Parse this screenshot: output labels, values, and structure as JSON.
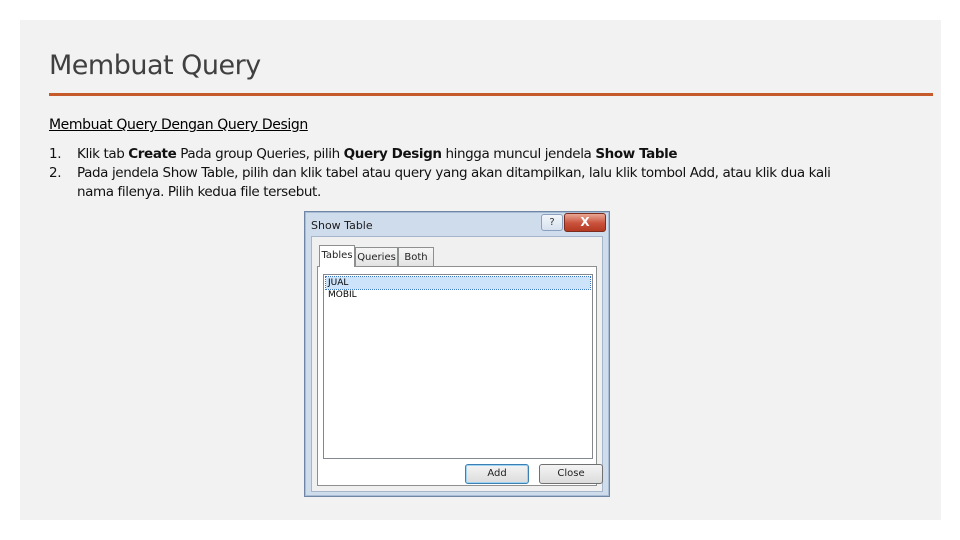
{
  "slide": {
    "title": "Membuat Query",
    "subheading": "Membuat Query Dengan Query Design",
    "steps": [
      {
        "num": "1.",
        "parts": [
          "Klik tab ",
          "Create",
          " Pada group Queries, pilih ",
          "Query Design",
          " hingga muncul jendela ",
          "Show Table"
        ]
      },
      {
        "num": "2.",
        "text": "Pada jendela Show Table, pilih dan klik tabel atau query yang akan ditampilkan, lalu klik tombol Add, atau klik dua kali nama filenya. Pilih kedua file tersebut."
      }
    ],
    "accent_color": "#c55a2b"
  },
  "dialog": {
    "title": "Show Table",
    "help_label": "?",
    "close_label": "X",
    "tabs": [
      "Tables",
      "Queries",
      "Both"
    ],
    "active_tab": "Tables",
    "list_items": [
      "JUAL",
      "MOBIL"
    ],
    "selected_item": "JUAL",
    "add_label": "Add",
    "close_button_label": "Close"
  }
}
